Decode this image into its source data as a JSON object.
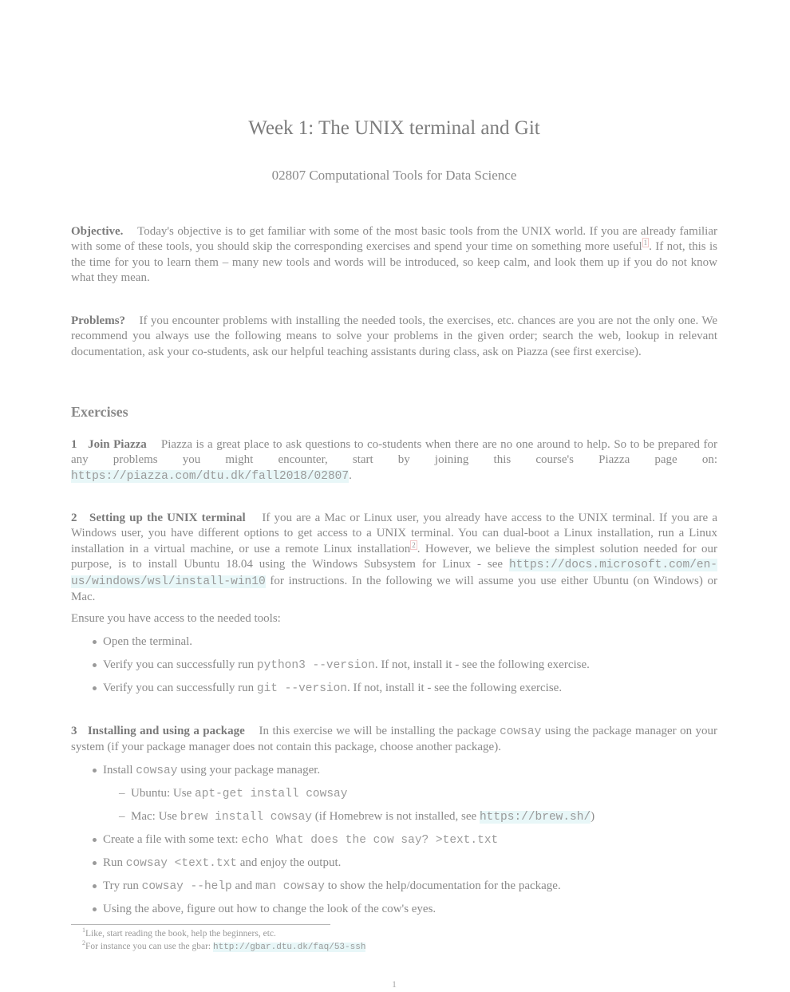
{
  "title": "Week 1: The UNIX terminal and Git",
  "subtitle": "02807 Computational Tools for Data Science",
  "objective": {
    "heading": "Objective.",
    "text_a": "Today's objective is to get familiar with some of the most basic tools from the UNIX world. If you are already familiar with some of these tools, you should skip the corresponding exercises and spend your time on something more useful",
    "fn": "1",
    "text_b": ". If not, this is the time for you to learn them – many new tools and words will be introduced, so keep calm, and look them up if you do not know what they mean."
  },
  "problems": {
    "heading": "Problems?",
    "text": "If you encounter problems with installing the needed tools, the exercises, etc. chances are you are not the only one. We recommend you always use the following means to solve your problems in the given order; search the web, lookup in relevant documentation, ask your co-students, ask our helpful teaching assistants during class, ask on Piazza (see first exercise)."
  },
  "exercises_heading": "Exercises",
  "ex1": {
    "num": "1",
    "heading": "Join Piazza",
    "text": "Piazza is a great place to ask questions to co-students when there are no one around to help. So to be prepared for any problems you might encounter, start by joining this course's Piazza page on:",
    "url": "https://piazza.com/dtu.dk/fall2018/02807",
    "end": "."
  },
  "ex2": {
    "num": "2",
    "heading": "Setting up the UNIX terminal",
    "text_a": "If you are a Mac or Linux user, you already have access to the UNIX terminal. If you are a Windows user, you have different options to get access to a UNIX terminal. You can dual-boot a Linux installation, run a Linux installation in a virtual machine, or use a remote Linux installation",
    "fn": "2",
    "text_b": ". However, we believe the simplest solution needed for our purpose, is to install Ubuntu 18.04 using the Windows Subsystem for Linux - see",
    "url": "https://docs.microsoft.com/en-us/windows/wsl/install-win10",
    "text_c": "for instructions. In the following we will assume you use either Ubuntu (on Windows) or Mac.",
    "ensure": "Ensure you have access to the needed tools:",
    "items": [
      {
        "pre": "Open the terminal.",
        "code": "",
        "post": ""
      },
      {
        "pre": "Verify you can successfully run",
        "code": "python3 --version",
        "post": ". If not, install it - see the following exercise."
      },
      {
        "pre": "Verify you can successfully run",
        "code": "git --version",
        "post": ". If not, install it - see the following exercise."
      }
    ]
  },
  "ex3": {
    "num": "3",
    "heading": "Installing and using a package",
    "text_a": "In this exercise we will be installing the package",
    "code": "cowsay",
    "text_b": "using the package manager on your system (if your package manager does not contain this package, choose another package).",
    "item1": {
      "pre": "Install",
      "code": "cowsay",
      "post": "using your package manager."
    },
    "sub1": {
      "pre": "Ubuntu: Use",
      "code": "apt-get install cowsay"
    },
    "sub2": {
      "pre": "Mac: Use",
      "code": "brew install cowsay",
      "mid": "(if Homebrew is not installed, see",
      "url": "https://brew.sh/",
      "post": ")"
    },
    "item2": {
      "pre": "Create a file with some text:",
      "code": "echo What does the cow say? >text.txt"
    },
    "item3": {
      "pre": "Run",
      "code": "cowsay <text.txt",
      "post": "and enjoy the output."
    },
    "item4": {
      "pre": "Try run",
      "code": "cowsay --help",
      "mid": "and",
      "code2": "man cowsay",
      "post": "to show the help/documentation for the package."
    },
    "item5": {
      "pre": "Using the above, figure out how to change the look of the cow's eyes."
    }
  },
  "footnotes": [
    {
      "num": "1",
      "text": "Like, start reading the book, help the beginners, etc.",
      "code": ""
    },
    {
      "num": "2",
      "text": "For instance you can use the gbar:",
      "code": "http://gbar.dtu.dk/faq/53-ssh"
    }
  ],
  "page_number": "1"
}
